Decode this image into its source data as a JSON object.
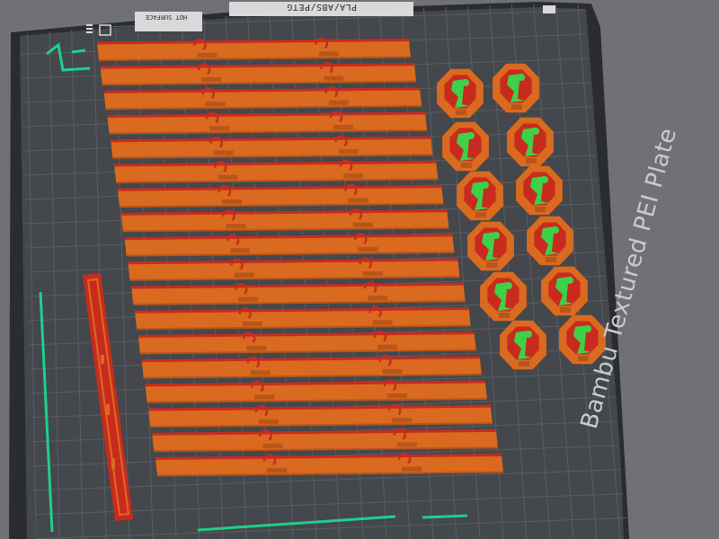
{
  "plate": {
    "name": "Bambu Textured PEI Plate",
    "filament_label": "PLA/ABS/PETG",
    "surface_label": "HOT SURFACE"
  },
  "colors": {
    "background": "#6f7175",
    "plate_border": "#2a2c30",
    "plate_surface": "#44474b",
    "grid_line": "#5a5d62",
    "accent_outline": "#1fd08a",
    "part_orange": "#d96a1f",
    "part_orange_dark": "#b8551a",
    "part_overhang_red": "#c82b1e",
    "support_green": "#3fd04a"
  },
  "objects": {
    "hook_strip_count": 18,
    "clip_count": 12,
    "long_bar_count": 1,
    "icons": [
      "plate-icon",
      "nozzle-icon"
    ]
  }
}
